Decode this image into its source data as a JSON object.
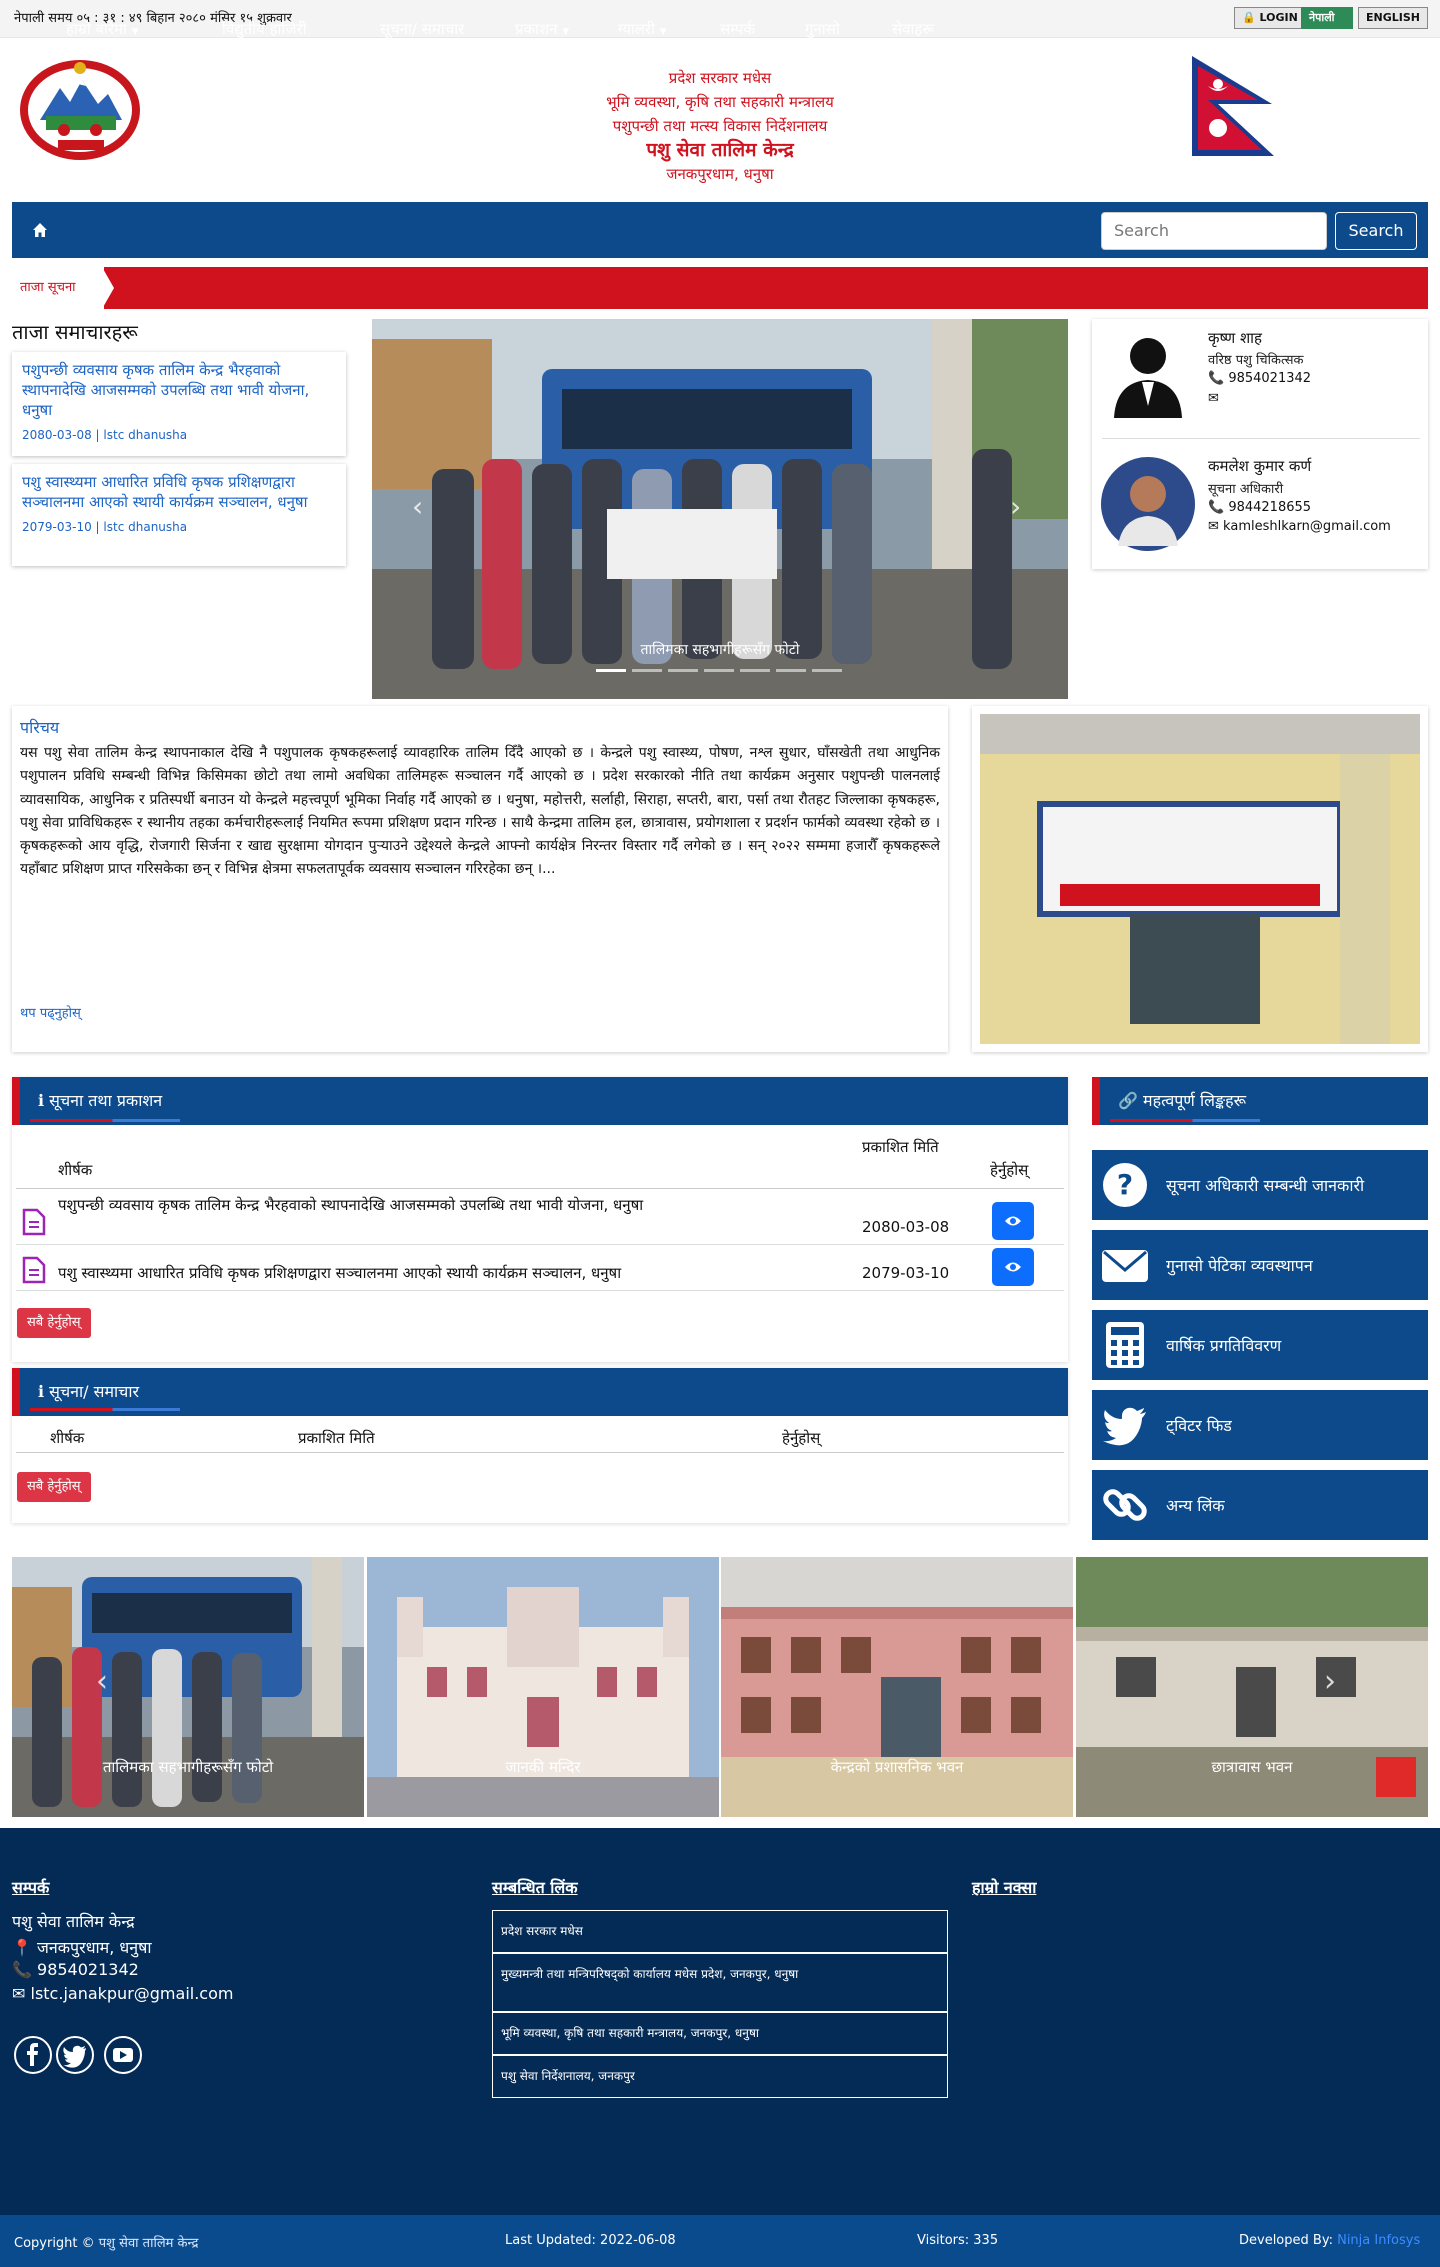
{
  "topbar": {
    "time": "नेपाली समय ०५ : ३१ : ४९ बिहान   २०८० मंसिर १५ शुक्रवार",
    "login": "LOGIN",
    "nepali": "नेपाली",
    "english": "ENGLISH"
  },
  "header": {
    "line1": "प्रदेश सरकार मधेस",
    "line2": "भूमि व्यवस्था, कृषि तथा सहकारी मन्त्रालय",
    "line3": "पशुपन्छी तथा मत्स्य विकास निर्देशनालय",
    "office": "पशु सेवा तालिम केन्द्र",
    "address": "जनकपुरधाम, धनुषा"
  },
  "nav": {
    "items": [
      "हाम्रो बारेमा",
      "विद्युतीय हाजिरी",
      "सूचना/ समाचार",
      "प्रकाशन",
      "ग्यालरी",
      "सम्पर्क",
      "गुनासो",
      "सेवाहरू"
    ],
    "search_placeholder": "Search",
    "search_button": "Search"
  },
  "ticker": {
    "label": "ताजा सूचना"
  },
  "news": {
    "heading": "ताजा समाचारहरू",
    "items": [
      {
        "title": "पशुपन्छी व्यवसाय कृषक तालिम केन्द्र भैरहवाको स्थापनादेखि आजसम्मको उपलब्धि तथा भावी योजना, धनुषा",
        "meta": "2080-03-08 | lstc dhanusha"
      },
      {
        "title": "पशु स्वास्थ्यमा आधारित प्रविधि कृषक प्रशिक्षणद्वारा सञ्चालनमा आएको स्थायी कार्यक्रम सञ्चालन, धनुषा",
        "meta": "2079-03-10 | lstc dhanusha"
      }
    ]
  },
  "carousel": {
    "caption": "तालिमका सहभागीहरूसँग फोटो"
  },
  "officials": [
    {
      "name": "कृष्ण शाह",
      "role": "वरिष्ठ पशु चिकित्सक",
      "phone": "9854021342",
      "email": ""
    },
    {
      "name": "कमलेश कुमार कर्ण",
      "role": "सूचना अधिकारी",
      "phone": "9844218655",
      "email": "kamleshlkarn@gmail.com"
    }
  ],
  "intro": {
    "title": "परिचय",
    "text": "यस पशु सेवा तालिम केन्द्र स्थापनाकाल देखि नै पशुपालक कृषकहरूलाई व्यावहारिक तालिम दिँदै आएको छ । केन्द्रले पशु स्वास्थ्य, पोषण, नश्ल सुधार, घाँसखेती तथा आधुनिक पशुपालन प्रविधि सम्बन्धी विभिन्न किसिमका छोटो तथा लामो अवधिका तालिमहरू सञ्चालन गर्दै आएको छ । प्रदेश सरकारको नीति तथा कार्यक्रम अनुसार पशुपन्छी पालनलाई व्यावसायिक, आधुनिक र प्रतिस्पर्धी बनाउन यो केन्द्रले महत्त्वपूर्ण भूमिका निर्वाह गर्दै आएको छ । धनुषा, महोत्तरी, सर्लाही, सिराहा, सप्तरी, बारा, पर्सा तथा रौतहट जिल्लाका कृषकहरू, पशु सेवा प्राविधिकहरू र स्थानीय तहका कर्मचारीहरूलाई नियमित रूपमा प्रशिक्षण प्रदान गरिन्छ । साथै केन्द्रमा तालिम हल, छात्रावास, प्रयोगशाला र प्रदर्शन फार्मको व्यवस्था रहेको छ । कृषकहरूको आय वृद्धि, रोजगारी सिर्जना र खाद्य सुरक्षामा योगदान पुर्‍याउने उद्देश्यले केन्द्रले आफ्नो कार्यक्षेत्र निरन्तर विस्तार गर्दै लगेको छ । सन् २०२२ सम्ममा हजारौँ कृषकहरूले यहाँबाट प्रशिक्षण प्राप्त गरिसकेका छन् र विभिन्न क्षेत्रमा सफलतापूर्वक व्यवसाय सञ्चालन गरिरहेका छन् ।...",
    "more": "थप पढ्नुहोस्"
  },
  "documents": {
    "heading": "सूचना तथा प्रकाशन",
    "col_title": "शीर्षक",
    "col_date": "प्रकाशित मिति",
    "col_action": "हेर्नुहोस्",
    "rows": [
      {
        "title": "पशुपन्छी व्यवसाय कृषक तालिम केन्द्र भैरहवाको स्थापनादेखि आजसम्मको उपलब्धि तथा भावी योजना, धनुषा",
        "date": "2080-03-08"
      },
      {
        "title": "पशु स्वास्थ्यमा आधारित प्रविधि कृषक प्रशिक्षणद्वारा सञ्चालनमा आएको स्थायी कार्यक्रम सञ्चालन, धनुषा",
        "date": "2079-03-10"
      }
    ],
    "all_button": "सबै हेर्नुहोस्"
  },
  "notices": {
    "heading": "सूचना/ समाचार",
    "col_title": "शीर्षक",
    "col_date": "प्रकाशित मिति",
    "col_action": "हेर्नुहोस्",
    "all_button": "सबै हेर्नुहोस्"
  },
  "links": {
    "heading": "महत्वपूर्ण लिङ्कहरू",
    "items": [
      "सूचना अधिकारी सम्बन्धी जानकारी",
      "गुनासो पेटिका व्यवस्थापन",
      "वार्षिक प्रगतिविवरण",
      "ट्विटर फिड",
      "अन्य लिंक"
    ]
  },
  "gallery": {
    "captions": [
      "तालिमका सहभागीहरूसँग फोटो",
      "जानकी मन्दिर",
      "केन्द्रको प्रशासनिक भवन",
      "छात्रावास भवन"
    ]
  },
  "footer": {
    "contact_heading": "सम्पर्क",
    "office": "पशु सेवा तालिम केन्द्र",
    "address": "जनकपुरधाम, धनुषा",
    "phone": "9854021342",
    "email": "lstc.janakpur@gmail.com",
    "links_heading": "सम्बन्धित लिंक",
    "links": [
      "प्रदेश सरकार मधेस",
      "मुख्यमन्त्री तथा मन्त्रिपरिषद्को कार्यालय मधेस प्रदेश, जनकपुर, धनुषा",
      "भूमि व्यवस्था, कृषि तथा सहकारी मन्त्रालय, जनकपुर, धनुषा",
      "पशु सेवा निर्देशनालय, जनकपुर"
    ],
    "map_heading": "हाम्रो नक्सा"
  },
  "bottom": {
    "copyright_prefix": "Copyright ©",
    "copyright_office": "पशु सेवा तालिम केन्द्र",
    "last_updated": "Last Updated: 2022-06-08",
    "visitors": "Visitors: 335",
    "developed_prefix": "Developed By:",
    "developer": "Ninja Infosys"
  }
}
